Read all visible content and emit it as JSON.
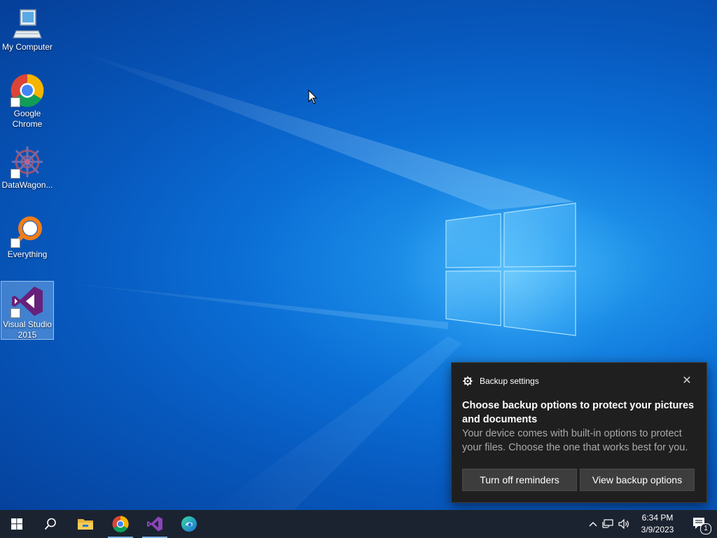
{
  "desktop": {
    "icons": [
      {
        "label": "My Computer",
        "icon": "computer-icon"
      },
      {
        "label": "Google Chrome",
        "icon": "chrome-icon"
      },
      {
        "label": "DataWagon...",
        "icon": "datawagon-icon"
      },
      {
        "label": "Everything",
        "icon": "everything-search-icon"
      },
      {
        "label": "Visual Studio 2015",
        "icon": "visual-studio-icon",
        "selected": true
      }
    ],
    "wallpaper": "windows-10-hero-logo"
  },
  "notification": {
    "app_name": "Backup settings",
    "app_icon": "gear-icon",
    "title": "Choose backup options to protect your pictures and documents",
    "body": "Your device comes with built-in options to protect your files. Choose the one that works best for you.",
    "buttons": {
      "dismiss": "Turn off reminders",
      "primary": "View backup options"
    },
    "close_icon": "close-icon"
  },
  "taskbar": {
    "pinned": [
      "start-icon",
      "search-icon",
      "file-explorer-icon",
      "chrome-icon",
      "visual-studio-icon",
      "edge-icon"
    ],
    "tray": [
      "chevron-up-icon",
      "network-icon",
      "volume-icon"
    ],
    "time": "6:34 PM",
    "date": "3/9/2023",
    "notification_count": "1"
  },
  "colors": {
    "taskbar_bg": "#1b2330",
    "toast_bg": "#1f1f1f",
    "toast_button_bg": "#3d3d3d",
    "vs_purple": "#68217a"
  }
}
